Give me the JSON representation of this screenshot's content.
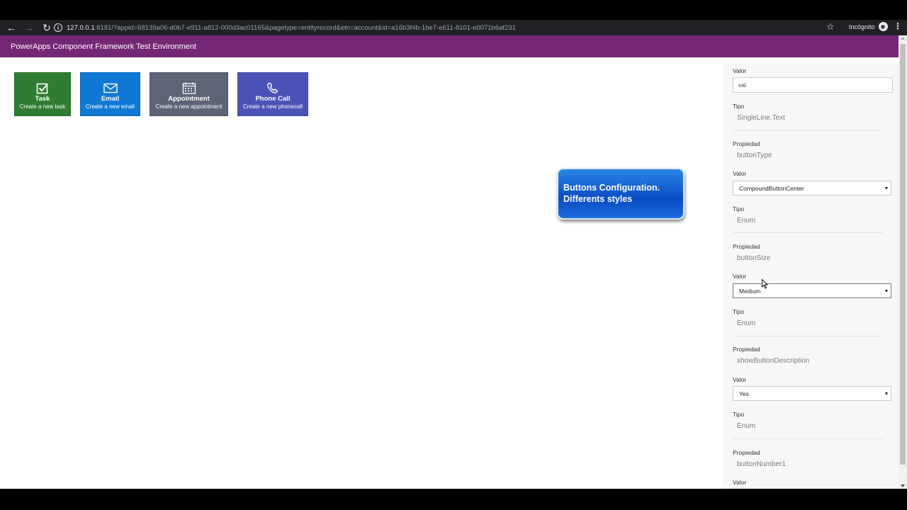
{
  "browser": {
    "url_host": "127.0.0.1",
    "url_rest": ":8181/?appid=68139a06-d0b7-e911-a812-000d3ac01165&pagetype=entityrecord&etn=account&id=a16b3f4b-1be7-e611-8101-e0071b6af231",
    "profile_label": "Incógnito"
  },
  "app": {
    "title": "PowerApps Component Framework Test Environment"
  },
  "buttons": [
    {
      "title": "Task",
      "description": "Create a new task",
      "color": "#2f7d32"
    },
    {
      "title": "Email",
      "description": "Create a new email",
      "color": "#0f78d4"
    },
    {
      "title": "Appointment",
      "description": "Create a new appointment",
      "color": "#5d6478"
    },
    {
      "title": "Phone Call",
      "description": "Create a new phonecall",
      "color": "#4b52b7"
    }
  ],
  "callout": {
    "line1": "Buttons Configuration.",
    "line2": "Differents styles"
  },
  "panel": {
    "valor_label": "Valor",
    "tipo_label": "Tipo",
    "propiedad_label": "Propiedad",
    "row0": {
      "value": "val",
      "tipo": "SingleLine.Text"
    },
    "row1": {
      "propiedad": "buttonType",
      "value": "CompoundButtonCenter",
      "tipo": "Enum"
    },
    "row2": {
      "propiedad": "buttonSize",
      "value": "Medium",
      "tipo": "Enum"
    },
    "row3": {
      "propiedad": "showButtonDescription",
      "value": "Yes",
      "tipo": "Enum"
    },
    "row4": {
      "propiedad": "buttonNumber1"
    }
  }
}
